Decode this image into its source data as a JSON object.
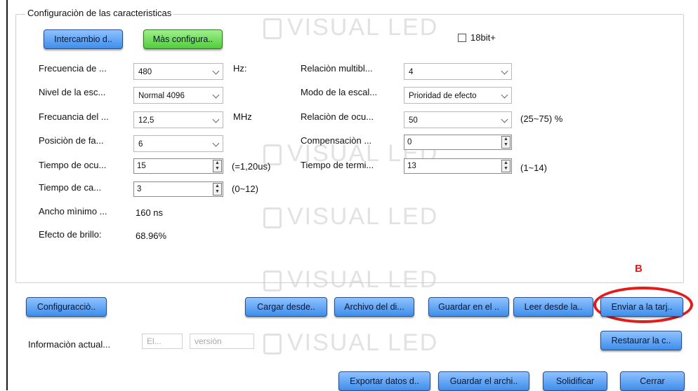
{
  "group_title": "Configuraciòn de las caracteristicas",
  "watermark_text": "VISUAL LED",
  "top_buttons": {
    "exchange": "Intercambio d..",
    "more_config": "Màs configura.."
  },
  "bit18": {
    "label": "18bit+",
    "checked": false
  },
  "left_fields": [
    {
      "label": "Frecuencia de ...",
      "value": "480",
      "unit": "Hz:"
    },
    {
      "label": "Nivel de la esc...",
      "value": "Normal 4096"
    },
    {
      "label": "Frecuancia del ...",
      "value": "12,5",
      "unit": "MHz"
    },
    {
      "label": "Posiciòn de fa...",
      "value": "6"
    },
    {
      "label": "Tiempo de ocu...",
      "value": "15",
      "unit": "(=1,20us)"
    },
    {
      "label": "Tiempo de ca...",
      "value": "3",
      "unit": "(0~12)"
    }
  ],
  "right_fields": [
    {
      "label": "Relaciòn  multibl...",
      "value": "4"
    },
    {
      "label": "Modo de la escal...",
      "value": "Prioridad de efecto"
    },
    {
      "label": "Relaciòn de ocu...",
      "value": "50",
      "unit": "(25~75) %"
    },
    {
      "label": "Compensaciòn ...",
      "value": "0"
    },
    {
      "label": "Tiempo de termi...",
      "value": "13",
      "unit": "(1~14)"
    }
  ],
  "info": [
    {
      "label": "Ancho mìnimo ...",
      "value": "160 ns"
    },
    {
      "label": "Efecto de brillo:",
      "value": "68.96%"
    }
  ],
  "action_buttons": {
    "config": "Configuracciò..",
    "load": "Cargar desde..",
    "file": "Archivo del di...",
    "save": "Guardar en el ..",
    "read": "Leer desde la..",
    "send": "Enviar a la tarj..",
    "restore": "Restaurar la c..",
    "export": "Exportar datos d..",
    "save_file": "Guardar el archi..",
    "solidify": "Solidificar",
    "close": "Cerrar"
  },
  "current_info": {
    "label": "Informaciòn actual...",
    "field1": "El...",
    "field2": "versiòn"
  },
  "annotation": {
    "letter": "B",
    "color": "#e41b1b"
  }
}
